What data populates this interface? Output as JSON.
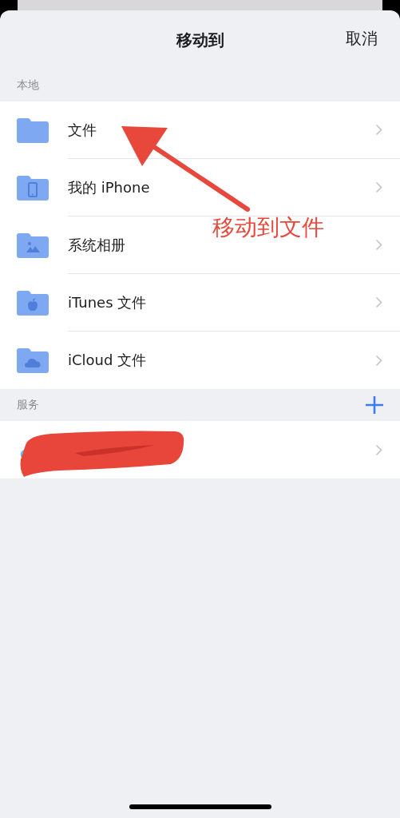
{
  "sheet": {
    "title": "移动到",
    "cancel": "取消"
  },
  "sections": [
    {
      "header": "本地",
      "add_button": false,
      "rows": [
        {
          "label": "文件",
          "kind": "folder"
        },
        {
          "label": "我的 iPhone",
          "kind": "phone"
        },
        {
          "label": "系统相册",
          "kind": "photos"
        },
        {
          "label": "iTunes 文件",
          "kind": "apple"
        },
        {
          "label": "iCloud 文件",
          "kind": "cloud"
        }
      ]
    },
    {
      "header": "服务",
      "add_button": true,
      "rows": [
        {
          "kind": "service",
          "redacted": true
        }
      ]
    }
  ],
  "annotation": {
    "text": "移动到文件"
  }
}
